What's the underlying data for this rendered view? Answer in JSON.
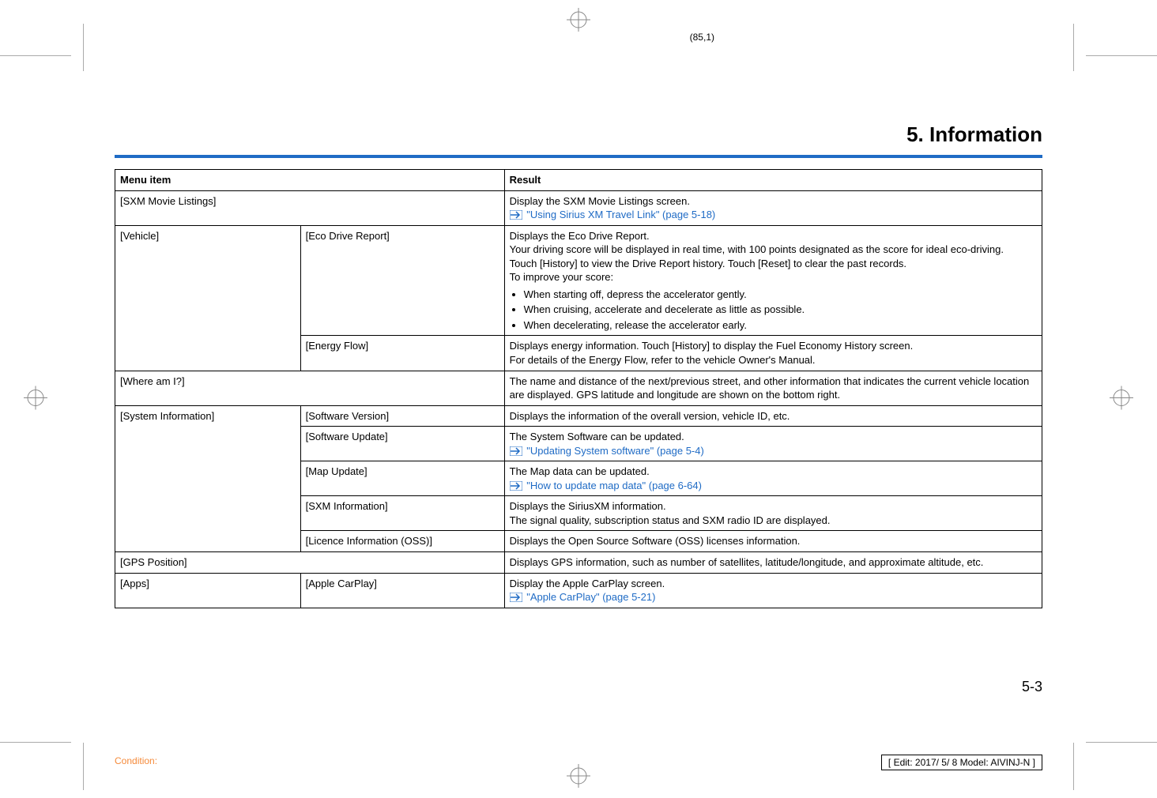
{
  "page_marker": "(85,1)",
  "chapter_title": "5. Information",
  "headers": {
    "menu": "Menu item",
    "result": "Result"
  },
  "rows": {
    "sxm_movie": {
      "menu": "[SXM Movie Listings]",
      "result_line1": "Display the SXM Movie Listings screen.",
      "ref": "\"Using Sirius XM Travel Link\" (page 5-18)"
    },
    "vehicle": {
      "menu": "[Vehicle]",
      "eco": {
        "sub": "[Eco Drive Report]",
        "p1": "Displays the Eco Drive Report.",
        "p2": "Your driving score will be displayed in real time, with 100 points designated as the score for ideal eco-driving.",
        "p3": "Touch [History] to view the Drive Report history. Touch [Reset] to clear the past records.",
        "p4": "To improve your score:",
        "b1": "When starting off, depress the accelerator gently.",
        "b2": "When cruising, accelerate and decelerate as little as possible.",
        "b3": "When decelerating, release the accelerator early."
      },
      "energy": {
        "sub": "[Energy Flow]",
        "p1": "Displays energy information. Touch [History] to display the Fuel Economy History screen.",
        "p2": "For details of the Energy Flow, refer to the vehicle Owner's Manual."
      }
    },
    "where": {
      "menu": "[Where am I?]",
      "result": "The name and distance of the next/previous street, and other information that indicates the current vehicle location are displayed. GPS latitude and longitude are shown on the bottom right."
    },
    "sysinfo": {
      "menu": "[System Information]",
      "swver": {
        "sub": "[Software Version]",
        "result": "Displays the information of the overall version, vehicle ID, etc."
      },
      "swupd": {
        "sub": "[Software Update]",
        "result_line1": "The System Software can be updated.",
        "ref": "\"Updating System software\" (page 5-4)"
      },
      "mapupd": {
        "sub": "[Map Update]",
        "result_line1": "The Map data can be updated.",
        "ref": "\"How to update map data\" (page 6-64)"
      },
      "sxminfo": {
        "sub": "[SXM Information]",
        "p1": "Displays the SiriusXM information.",
        "p2": "The signal quality, subscription status and SXM radio ID are displayed."
      },
      "oss": {
        "sub": "[Licence Information (OSS)]",
        "result": "Displays the Open Source Software (OSS) licenses information."
      }
    },
    "gps": {
      "menu": "[GPS Position]",
      "result": "Displays GPS information, such as number of satellites, latitude/longitude, and approximate altitude, etc."
    },
    "apps": {
      "menu": "[Apps]",
      "sub": "[Apple CarPlay]",
      "result_line1": "Display the Apple CarPlay screen.",
      "ref": "\"Apple CarPlay\" (page 5-21)"
    }
  },
  "page_number": "5-3",
  "condition_label": "Condition:",
  "edit_box": "[ Edit: 2017/ 5/ 8   Model:  AIVINJ-N ]"
}
